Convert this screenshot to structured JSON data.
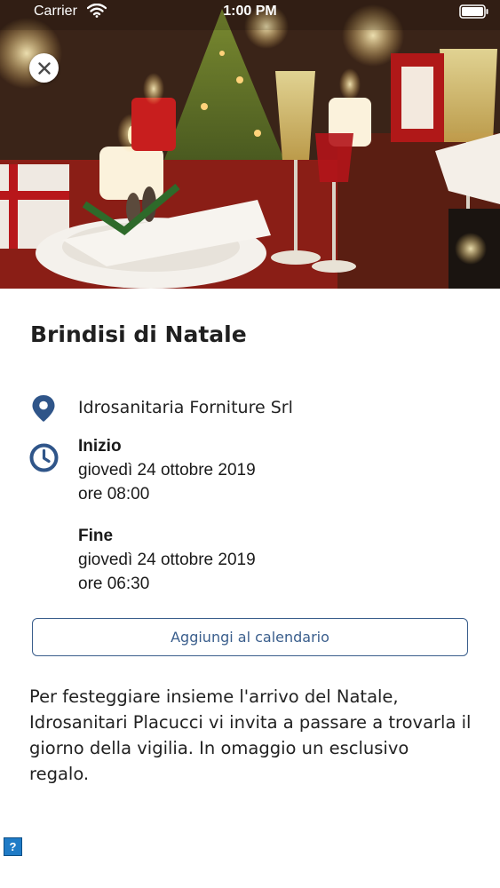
{
  "status_bar": {
    "carrier": "Carrier",
    "time": "1:00 PM"
  },
  "event": {
    "title": "Brindisi di Natale",
    "location": "Idrosanitaria Forniture Srl",
    "start": {
      "label": "Inizio",
      "date": "giovedì 24 ottobre 2019",
      "time": "ore 08:00"
    },
    "end": {
      "label": "Fine",
      "date": "giovedì 24 ottobre 2019",
      "time": "ore 06:30"
    },
    "add_calendar_label": "Aggiungi al calendario",
    "description": "Per festeggiare insieme l'arrivo del Natale, Idrosanitari Placucci vi invita a passare a trovarla il giorno della vigilia. In omaggio un esclusivo regalo."
  },
  "help": {
    "label": "?"
  },
  "colors": {
    "accent": "#3a5e8c",
    "icon": "#2f5589"
  },
  "icons": [
    "close-icon",
    "location-pin-icon",
    "clock-icon",
    "wifi-icon",
    "battery-icon",
    "help-icon"
  ]
}
